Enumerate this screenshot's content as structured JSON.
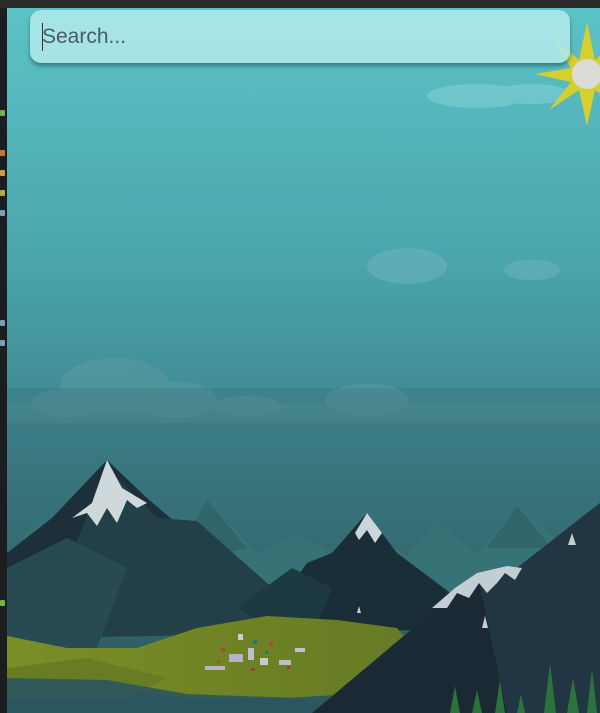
{
  "search": {
    "placeholder": "Search...",
    "value": ""
  },
  "background": {
    "sky_top_color": "#5cc4c9",
    "sky_bottom_color": "#36656c",
    "sun_color": "#d8d230",
    "meadow_color": "#8a9a22",
    "mountain_color": "#1e3a44"
  }
}
